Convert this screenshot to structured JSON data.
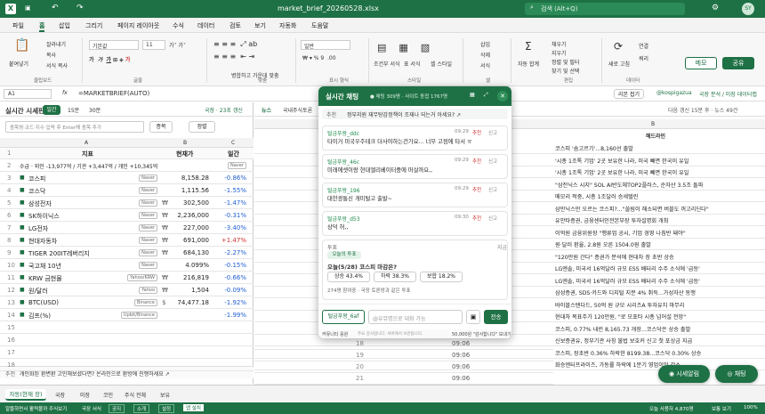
{
  "titlebar": {
    "filename": "market_brief_20260528.xlsx",
    "search": "검색 (Alt+Q)",
    "avatar": "SY"
  },
  "menu": [
    "파일",
    "홈",
    "삽입",
    "그리기",
    "페이지 레이아웃",
    "수식",
    "데이터",
    "검토",
    "보기",
    "자동화",
    "도움말"
  ],
  "ribbon": {
    "paste": "붙여넣기",
    "cut": "잘라내기",
    "copy": "복사",
    "format_painter": "서식 복사",
    "clipboard": "클립보드",
    "font_name": "기본값",
    "font_size": "11",
    "font": "글꼴",
    "align": "맞춤",
    "merge": "병합하고 가운데 맞춤",
    "number_format": "일반",
    "number": "표시 형식",
    "cond": "조건부 서식",
    "table": "표 서식",
    "cellstyle": "셀 스타일",
    "style": "스타일",
    "insert": "삽입",
    "delete": "삭제",
    "format": "서식",
    "cells": "셀",
    "sum": "자동 합계",
    "fill": "채우기",
    "clear": "지우기",
    "sort": "정렬 및 필터",
    "find": "찾기 및 선택",
    "edit": "편집",
    "refresh": "새로 고침",
    "data": "데이터",
    "link": "연결",
    "query": "쿼리",
    "memo": "메모",
    "share": "공유"
  },
  "formula": {
    "cell": "A1",
    "fx": "fx",
    "value": "=MARKETBRIEF(AUTO)",
    "mode": "리본 접기",
    "account": "@kospigazua",
    "notice": "국장 분석 / 미장 데이터랩"
  },
  "panel": {
    "title": "실시간 시세판",
    "tabs": [
      "일간",
      "15분",
      "30분"
    ],
    "status": "국장 · 23초 갱신",
    "search_placeholder": "종목명·코드·지수 입력 후 Enter해 종목 추가",
    "btn_stock": "종목",
    "btn_sort": "정렬",
    "col_a": "A",
    "col_b": "B",
    "col_c": "C",
    "h_index": "지표",
    "h_price": "현재가",
    "h_change": "일간",
    "summary": "수급 · 외인 -13,977억 / 기관 +3,447억 / 개인 +10,345억",
    "summary_tag": "Naver",
    "rows": [
      {
        "n": "3",
        "name": "코스피",
        "tag": "Naver",
        "unit": "",
        "price": "8,158.28",
        "chg": "-0.86%"
      },
      {
        "n": "4",
        "name": "코스닥",
        "tag": "Naver",
        "unit": "",
        "price": "1,115.56",
        "chg": "-1.55%"
      },
      {
        "n": "5",
        "name": "삼성전자",
        "tag": "Naver",
        "unit": "₩",
        "price": "302,500",
        "chg": "-1.47%"
      },
      {
        "n": "6",
        "name": "SK하이닉스",
        "tag": "Naver",
        "unit": "₩",
        "price": "2,236,000",
        "chg": "-0.31%"
      },
      {
        "n": "7",
        "name": "LG전자",
        "tag": "Naver",
        "unit": "₩",
        "price": "227,000",
        "chg": "-3.40%"
      },
      {
        "n": "8",
        "name": "현대자동차",
        "tag": "Naver",
        "unit": "₩",
        "price": "691,000",
        "chg": "+1.47%"
      },
      {
        "n": "9",
        "name": "TIGER 200IT레버리지",
        "tag": "Naver",
        "unit": "₩",
        "price": "684,130",
        "chg": "-2.27%"
      },
      {
        "n": "10",
        "name": "국고채 10년",
        "tag": "Naver",
        "unit": "",
        "price": "4.099%",
        "chg": "-0.15%"
      },
      {
        "n": "11",
        "name": "KRW 금현물",
        "tag": "Yahoo/KRW",
        "unit": "₩",
        "price": "216,819",
        "chg": "-0.66%"
      },
      {
        "n": "12",
        "name": "원/달러",
        "tag": "Yahoo",
        "unit": "₩",
        "price": "1,504",
        "chg": "-0.09%"
      },
      {
        "n": "13",
        "name": "BTC(USD)",
        "tag": "Binance",
        "unit": "$",
        "price": "74,477.18",
        "chg": "-1.92%"
      },
      {
        "n": "14",
        "name": "김프(%)",
        "tag": "Upbit/Binance",
        "unit": "",
        "price": "",
        "chg": "-1.99%"
      }
    ],
    "empty_rows": [
      "15",
      "16",
      "17",
      "18",
      "19",
      "20",
      "21"
    ],
    "footer": "개인화된 환변환 고민해보셨다면? 온라인으로 환방에 진행하세요 ↗",
    "footer_label": "추천"
  },
  "right": {
    "tabs": [
      "뉴스",
      "국내주식토론"
    ],
    "update": "다음 갱신 15분 후 · 뉴스 49건",
    "col_b": "B",
    "header": "헤드라인",
    "headlines": [
      "코스피 '숨고르기'...8,160선 출발",
      "'시총 1조톡 기업' 2곳 보유한 나라, 미국 빼면 한국이 유일",
      "'시총 1조톡 기업' 2곳 보유한 나라, 미국 빼면 한국이 유일",
      "\"삼전닉스 시지\" SOL AI반도체TOP2플러스, 순자산 3.5조 돌파",
      "메모리 적중, 시총 1조달러 승세텔린",
      "삼만닉스만 오르는 코스피?...\"쏠림이 해소되면 버블도 꺼고리딘다\"",
      "유안타증권, 금융센터인전본부장 투자설명회 개최",
      "이억원 금융위원장 \"행류업 공시, 기업 경영 나침반 돼야\"",
      "원·달러 환율, 2.8원 오른 1504.0원 출발",
      "\"120만원 간다\" 증권가 분석에 현대차 장 초반 상승",
      "LG엔솔, 미국서 16억달러 규모 ESS 배터리 수주 소식에 '급등'",
      "LG엔솔, 미국서 16억달러 규모 ESS 배터리 수주 소식에 '급등'",
      "삼성증권, SDS·카드와 디지털 지분 4% 취득...가성자산 동맹",
      "바이블스탠다드, 50억 원 규모 시리즈A 투자유치 마무리",
      "현대차 목표주가 120만원, \"로 모포타 시총 넘어설 전망\"",
      "코스피, 0.77% 내린 8,165.73 개장...코스닥은 상승 출발",
      "신보증권유, 정부기관 사칭 불법 보호커 신고 첫 포상금 지급",
      "코스피, 장초반 0.36% 하락한 8199.38...코스닥 0.30% 상승",
      "화승엔터프라이즈, 가동률 하락에 1분기 영업이익 감소"
    ],
    "rows2": [
      {
        "n": "18",
        "t": "09:06"
      },
      {
        "n": "19",
        "t": "09:06"
      },
      {
        "n": "20",
        "t": "09:06"
      },
      {
        "n": "21",
        "t": "09:06"
      }
    ]
  },
  "chat": {
    "title": "실시간 채팅",
    "sub": "● 채팅 309명 · 사이트 동접 1767명",
    "pinned_label": "추천",
    "pinned": "정부지원 재무탕감정책이 조재나 되는거 아세요? ↗",
    "msgs": [
      {
        "user": "털금푸왕_ddc",
        "time": "09:29",
        "msg": "타이거 미국우주테크 더사야하는건가요... 너무 고점에 타서 ㅠ"
      },
      {
        "user": "털금푸왕_46c",
        "time": "09:29",
        "msg": "미래에셋이랑 현대엘리베이터중에 머살까요,,"
      },
      {
        "user": "털금푸왕_196",
        "time": "09:29",
        "msg": "대한광통신 개미털고 출발~"
      },
      {
        "user": "털금푸왕_d53",
        "time": "09:30",
        "msg": "상덕 허,,"
      }
    ],
    "rec": "추천",
    "report": "신고",
    "poll": {
      "tag": "투표",
      "badge": "오늘의 투표",
      "q": "오늘(5/28) 코스피 마감은?",
      "opts": [
        "상승 43.4%",
        "하락 38.3%",
        "보합 18.2%"
      ],
      "meta": "274명 참여중 · 국장 토론방과 같은 투표",
      "now": "지금"
    },
    "input_user": "털금푸왕_6af",
    "input_placeholder": "@유뮤명으로 대화 가능",
    "send": "전송",
    "footer_l": "커뮤니티 응원",
    "footer_m": "주요 감사합니다. 서버에서 보관됩니다.",
    "footer_r": "50,000원 \"감사합니다\" 보내기"
  },
  "fabs": {
    "alert": "시세알림",
    "chat": "채팅"
  },
  "sheettabs": [
    "자동(현재 장)",
    "국장",
    "미장",
    "코인",
    "주식 전체",
    "보유"
  ],
  "statusbar": {
    "left": "알뜰하면서 활력볼까 주식보기",
    "mid": "국장 서식",
    "btns": [
      "공지",
      "소개",
      "설정",
      "앱 설치"
    ],
    "right": "오늘 사용자 4,870명",
    "zoom": "보통 보기",
    "pct": "100%"
  },
  "colors": {
    "green": "#1e7145",
    "accent": "#21a366",
    "neg": "#1f5fd1",
    "pos": "#d32f2f"
  }
}
